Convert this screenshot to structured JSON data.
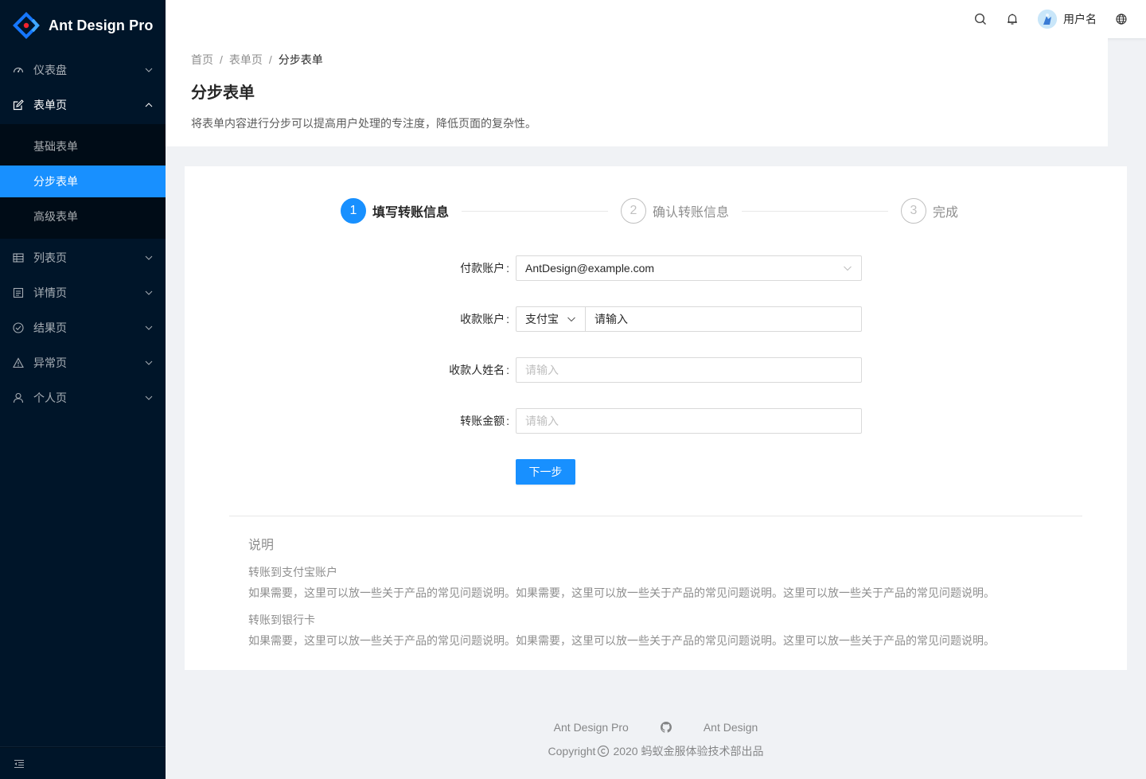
{
  "app": {
    "title": "Ant Design Pro"
  },
  "header": {
    "username": "用户名"
  },
  "sidebar": {
    "items": [
      {
        "label": "仪表盘",
        "icon": "dashboard-icon"
      },
      {
        "label": "表单页",
        "icon": "form-icon",
        "open": true,
        "children": [
          {
            "label": "基础表单"
          },
          {
            "label": "分步表单",
            "selected": true
          },
          {
            "label": "高级表单"
          }
        ]
      },
      {
        "label": "列表页",
        "icon": "table-icon"
      },
      {
        "label": "详情页",
        "icon": "profile-icon"
      },
      {
        "label": "结果页",
        "icon": "check-circle-icon"
      },
      {
        "label": "异常页",
        "icon": "warning-icon"
      },
      {
        "label": "个人页",
        "icon": "user-icon"
      }
    ]
  },
  "breadcrumb": [
    "首页",
    "表单页",
    "分步表单"
  ],
  "page": {
    "title": "分步表单",
    "description": "将表单内容进行分步可以提高用户处理的专注度，降低页面的复杂性。"
  },
  "steps": [
    {
      "number": "1",
      "title": "填写转账信息",
      "status": "active"
    },
    {
      "number": "2",
      "title": "确认转账信息",
      "status": "wait"
    },
    {
      "number": "3",
      "title": "完成",
      "status": "wait"
    }
  ],
  "form": {
    "pay_account": {
      "label": "付款账户",
      "value": "AntDesign@example.com"
    },
    "receiver_account": {
      "label": "收款账户",
      "type_value": "支付宝",
      "placeholder": "请输入"
    },
    "receiver_name": {
      "label": "收款人姓名",
      "placeholder": "请输入"
    },
    "amount": {
      "label": "转账金额",
      "placeholder": "请输入"
    },
    "submit_label": "下一步"
  },
  "notes": {
    "title": "说明",
    "sections": [
      {
        "heading": "转账到支付宝账户",
        "text": "如果需要，这里可以放一些关于产品的常见问题说明。如果需要，这里可以放一些关于产品的常见问题说明。这里可以放一些关于产品的常见问题说明。"
      },
      {
        "heading": "转账到银行卡",
        "text": "如果需要，这里可以放一些关于产品的常见问题说明。如果需要，这里可以放一些关于产品的常见问题说明。这里可以放一些关于产品的常见问题说明。"
      }
    ]
  },
  "footer": {
    "links": [
      "Ant Design Pro",
      "Ant Design"
    ],
    "copyright": "Copyright",
    "copyright_rest": "2020 蚂蚁金服体验技术部出品"
  },
  "colors": {
    "primary": "#1890ff",
    "sider": "#001529",
    "sider_sub": "#000c17"
  }
}
